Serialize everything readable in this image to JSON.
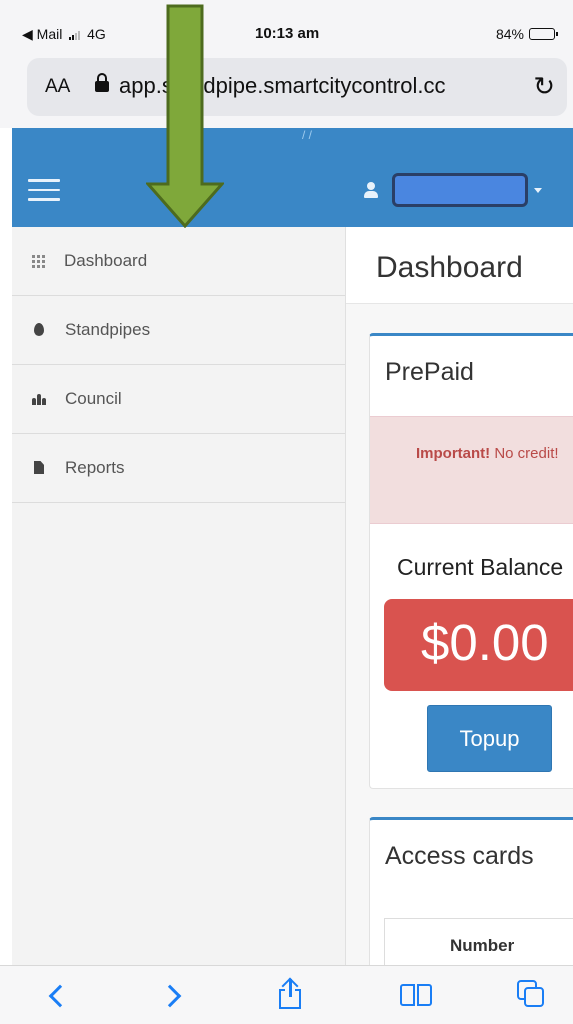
{
  "status_bar": {
    "carrier": "◀ Mail",
    "network": "4G",
    "time": "10:13 am",
    "battery_percent": "84%",
    "battery_level": 0.84
  },
  "browser": {
    "text_size_label": "AA",
    "url": "app.standpipe.smartcitycontrol.cc",
    "reload_icon": "reload-icon"
  },
  "header": {
    "menu_icon": "hamburger-icon",
    "user_icon": "user-icon",
    "color": "#3a87c6"
  },
  "sidebar": {
    "items": [
      {
        "label": "Dashboard",
        "icon": "grid-icon"
      },
      {
        "label": "Standpipes",
        "icon": "drop-icon"
      },
      {
        "label": "Council",
        "icon": "group-icon"
      },
      {
        "label": "Reports",
        "icon": "document-icon"
      }
    ]
  },
  "main": {
    "page_title": "Dashboard",
    "prepaid": {
      "title": "PrePaid",
      "alert_strong": "Important!",
      "alert_text": " No credit!",
      "balance_label": "Current Balance",
      "balance_value": "$0.00",
      "topup_label": "Topup"
    },
    "access_cards": {
      "title": "Access cards",
      "columns": [
        "Number"
      ]
    }
  },
  "toolbar": {
    "icons": [
      "back-icon",
      "forward-icon",
      "share-icon",
      "bookmarks-icon",
      "tabs-icon"
    ]
  },
  "colors": {
    "primary": "#3a87c6",
    "danger": "#d9534f",
    "alert_bg": "#f2dede",
    "annotation_arrow": "#7fa83a",
    "safari_blue": "#1a7ef5"
  }
}
